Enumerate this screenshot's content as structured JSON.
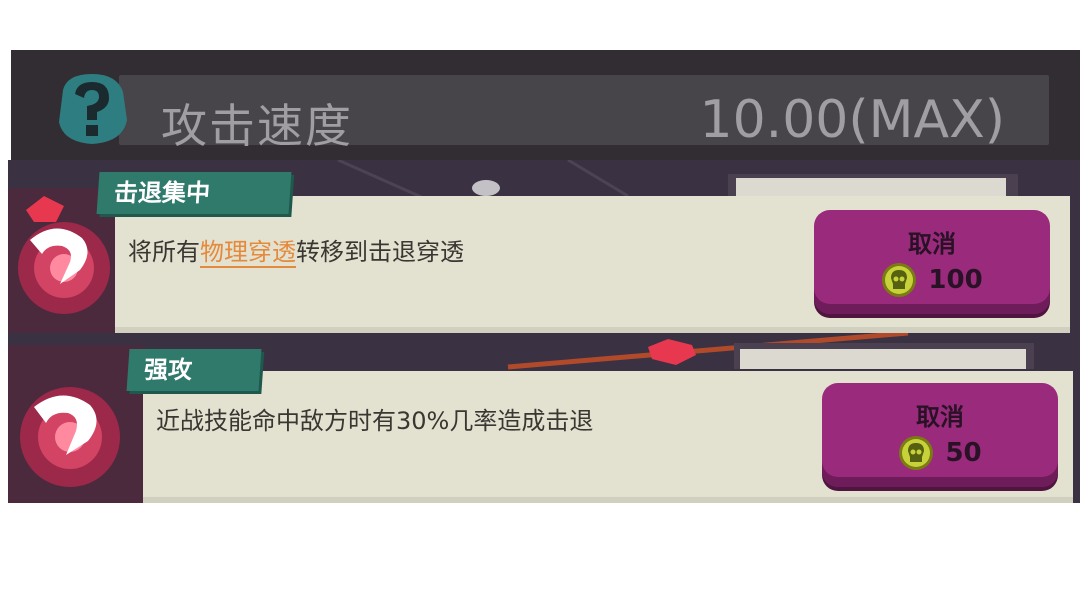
{
  "stat": {
    "name": "攻击速度",
    "value": "10.00(MAX)",
    "icon": "question-mark-icon"
  },
  "skills": [
    {
      "tag": "击退集中",
      "desc_prefix": "将所有",
      "desc_highlight": "物理穿透",
      "desc_suffix": "转移到击退穿透",
      "button_label": "取消",
      "cost": "100",
      "icon": "hook-swirl-icon"
    },
    {
      "tag": "强攻",
      "desc": "近战技能命中敌方时有30%几率造成击退",
      "button_label": "取消",
      "cost": "50",
      "icon": "hook-swirl-icon"
    }
  ],
  "colors": {
    "panel": "#e3e1d0",
    "tag": "#2f7a6b",
    "button": "#9a2a7c",
    "highlight": "#e48a3c",
    "coin": "#c7d23a"
  }
}
